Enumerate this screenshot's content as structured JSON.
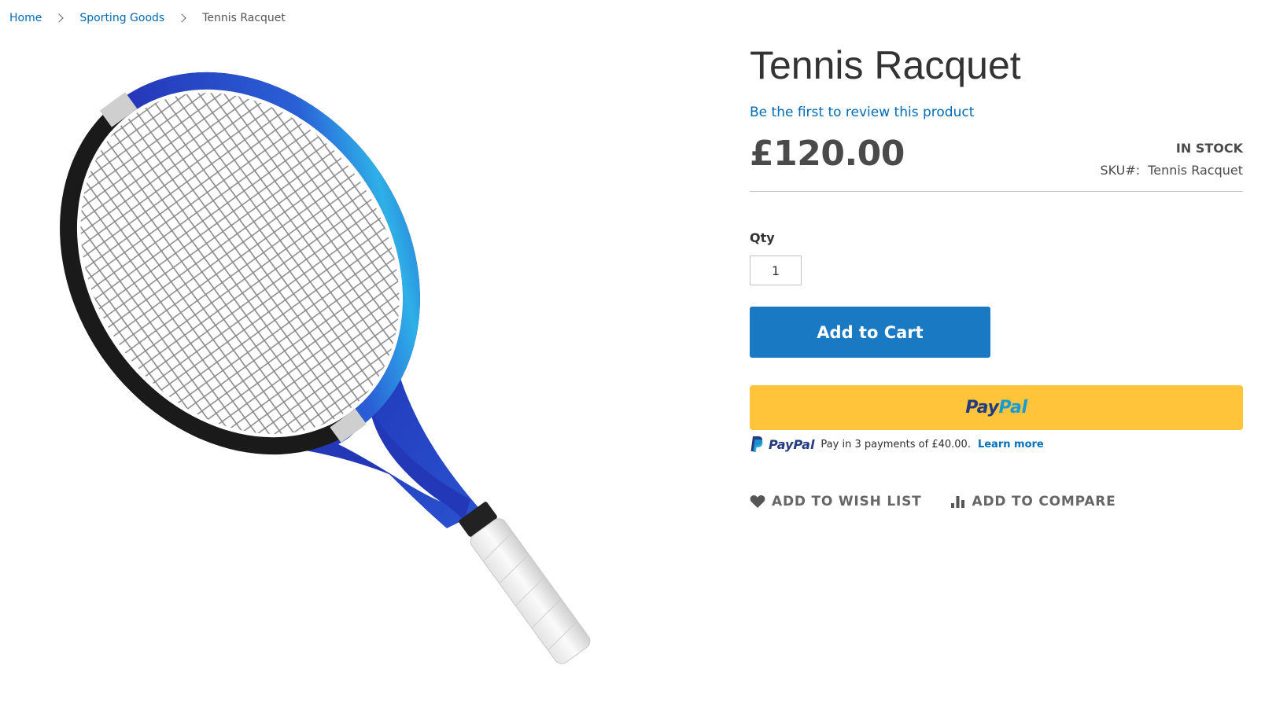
{
  "breadcrumb": {
    "home": "Home",
    "category": "Sporting Goods",
    "current": "Tennis Racquet"
  },
  "product": {
    "name": "Tennis Racquet",
    "review_link": "Be the first to review this product",
    "price": "£120.00",
    "stock_status": "IN STOCK",
    "sku_label": "SKU#:",
    "sku_value": "Tennis Racquet",
    "image_icon": "tennis-racquet-image"
  },
  "purchase": {
    "qty_label": "Qty",
    "qty_value": "1",
    "add_to_cart": "Add to Cart"
  },
  "paypal": {
    "button_logo_pay": "Pay",
    "button_logo_pal": "Pal",
    "paylater_logo": "PayPal",
    "paylater_text": "Pay in 3 payments of £40.00.",
    "learn_more": "Learn more"
  },
  "actions": {
    "wishlist": "ADD TO WISH LIST",
    "compare": "ADD TO COMPARE",
    "wishlist_icon": "heart-icon",
    "compare_icon": "bar-chart-icon"
  },
  "colors": {
    "link": "#006bb4",
    "primary_button": "#1979c3",
    "paypal_yellow": "#ffc439",
    "paypal_dark_blue": "#253b80",
    "paypal_light_blue": "#179bd7"
  }
}
